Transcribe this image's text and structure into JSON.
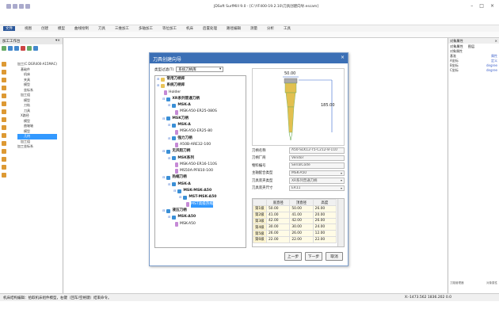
{
  "app": {
    "title": "JDSoft SurfMill 9.0 - [C:\\YF400-19.2.10\\刀具创建向导.escam]",
    "menu": [
      "文件",
      "视图",
      "创建",
      "模型",
      "曲线绘制",
      "刀具",
      "三维加工",
      "多轴加工",
      "等位加工",
      "机床",
      "后置处理",
      "路径编辑",
      "测量",
      "分析",
      "工具"
    ],
    "active_menu": "文件"
  },
  "left_panel": {
    "title": "加工工作台",
    "tree": [
      "加工(C:DGR400-A15MAC)",
      "基础件",
      "机床",
      "夹具",
      "模型",
      "坐标系",
      "加工组",
      "模型",
      "刀轨",
      "刀具",
      "X路径",
      "模型",
      "曲轴轴",
      "模型",
      "几何",
      "加工组",
      "加工坐标系"
    ],
    "selected_index": 14
  },
  "right_panel": {
    "title": "对象属性",
    "tabs": [
      "对象属性",
      "图层"
    ],
    "rows": [
      {
        "k": "对象属性",
        "v": ""
      },
      {
        "k": "基准",
        "v": "属性"
      },
      {
        "k": "A坐标",
        "v": "定义"
      },
      {
        "k": "B坐标",
        "v": "degree"
      },
      {
        "k": "C坐标",
        "v": "degree"
      }
    ],
    "footer_left": "刀路管理器",
    "footer_right": "对象属性"
  },
  "status": {
    "message": "机床结构编辑：拾取机床组件模型，右键（回车/空格键）结束命令。",
    "coords": "X:-1473.562  1836.202  0.0"
  },
  "dialog": {
    "title": "刀具创建向导",
    "filter_label": "类型过滤(T)",
    "filter_value": "系统刀柄库",
    "tree": [
      {
        "label": "常用刀柄库",
        "level": 0,
        "icon": "f",
        "bold": true
      },
      {
        "label": "系统刀柄库",
        "level": 0,
        "icon": "f",
        "bold": true
      },
      {
        "label": "Holder",
        "level": 1,
        "icon": "p",
        "bold": false
      },
      {
        "label": "XR系列普通刀柄",
        "level": 1,
        "icon": "b",
        "bold": true
      },
      {
        "label": "MSK-A",
        "level": 2,
        "icon": "b",
        "bold": true
      },
      {
        "label": "MSK-A50-ER25-080S",
        "level": 3,
        "icon": "p",
        "bold": false
      },
      {
        "label": "MSK刀柄",
        "level": 1,
        "icon": "b",
        "bold": true
      },
      {
        "label": "MSK-A",
        "level": 2,
        "icon": "b",
        "bold": true
      },
      {
        "label": "MSK-A50-ER25-80",
        "level": 3,
        "icon": "p",
        "bold": false
      },
      {
        "label": "强力刀柄",
        "level": 2,
        "icon": "b",
        "bold": true
      },
      {
        "label": "A50B-ARE32-100",
        "level": 3,
        "icon": "p",
        "bold": false
      },
      {
        "label": "无风阻刀柄",
        "level": 1,
        "icon": "b",
        "bold": true
      },
      {
        "label": "MSK系列",
        "level": 2,
        "icon": "b",
        "bold": true
      },
      {
        "label": "MSK-A50-ER16-110S",
        "level": 3,
        "icon": "p",
        "bold": false
      },
      {
        "label": "MS50A-PF810-100",
        "level": 3,
        "icon": "p",
        "bold": false
      },
      {
        "label": "热缩刀柄",
        "level": 1,
        "icon": "b",
        "bold": true
      },
      {
        "label": "MSK-A",
        "level": 2,
        "icon": "b",
        "bold": true
      },
      {
        "label": "MSK-MSK-A50",
        "level": 3,
        "icon": "b",
        "bold": true
      },
      {
        "label": "MST-MSK-A50",
        "level": 4,
        "icon": "b",
        "bold": true
      },
      {
        "label": "MST高级热缩",
        "level": 5,
        "icon": "p",
        "bold": false,
        "selected": true
      },
      {
        "label": "液压刀柄",
        "level": 1,
        "icon": "b",
        "bold": true
      },
      {
        "label": "MSK-A50",
        "level": 2,
        "icon": "b",
        "bold": true
      },
      {
        "label": "MSK-A50",
        "level": 3,
        "icon": "p",
        "bold": false
      }
    ],
    "preview": {
      "dim_top": "50.00",
      "dim_right": "185.00"
    },
    "fields": [
      {
        "label": "刀柄名称",
        "value": "A50-SLK12-T5-C212-8-110",
        "dropdown": false
      },
      {
        "label": "刀柄厂商",
        "value": "Vendor",
        "dropdown": false
      },
      {
        "label": "物料编号",
        "value": "SerialCode",
        "dropdown": false
      },
      {
        "label": "主轴配合类型",
        "value": "MSK-A50",
        "dropdown": true
      },
      {
        "label": "刀具装夹类型",
        "value": "XR系列普通刀柄",
        "dropdown": true
      },
      {
        "label": "刀具装夹尺寸",
        "value": "ER11",
        "dropdown": true
      }
    ],
    "grid": {
      "headers": [
        "",
        "底直径",
        "顶直径",
        "高度"
      ],
      "rows": [
        [
          "第1级",
          "50.00",
          "50.00",
          "26.00"
        ],
        [
          "第2级",
          "41.00",
          "41.00",
          "20.00"
        ],
        [
          "第3级",
          "42.00",
          "42.00",
          "26.00"
        ],
        [
          "第4级",
          "30.00",
          "30.00",
          "24.00"
        ],
        [
          "第5级",
          "26.00",
          "26.00",
          "12.00"
        ],
        [
          "第6级",
          "22.00",
          "22.00",
          "22.00"
        ]
      ]
    },
    "buttons": {
      "prev": "上一步",
      "next": "下一步",
      "cancel": "取消"
    }
  }
}
